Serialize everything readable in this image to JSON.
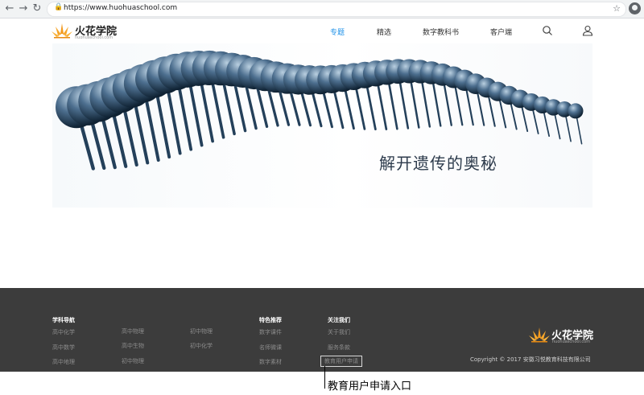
{
  "browser": {
    "url": "https://www.huohuaschool.com",
    "back_icon": "←",
    "forward_icon": "→",
    "reload_icon": "↻",
    "lock_icon": "🔒",
    "star_icon": "☆"
  },
  "header": {
    "brand_name": "火花学院",
    "brand_domain": "huohuaschool.com",
    "menu": [
      {
        "label": "专题",
        "active": true
      },
      {
        "label": "精选",
        "active": false
      },
      {
        "label": "数字教科书",
        "active": false
      },
      {
        "label": "客户端",
        "active": false
      }
    ],
    "accent_color": "#1a8fe8",
    "logo_color": "#f39a1e"
  },
  "banner": {
    "title": "解开遗传的奥秘"
  },
  "footer": {
    "columns": [
      {
        "heading": "学科导航",
        "links": [
          "高中化学",
          "高中数学",
          "高中地理"
        ]
      },
      {
        "heading": "",
        "links": [
          "高中物理",
          "高中生物",
          "初中物理"
        ]
      },
      {
        "heading": "",
        "links": [
          "初中物理",
          "初中化学"
        ]
      },
      {
        "heading": "特色推荐",
        "links": [
          "数字课件",
          "名师微课",
          "数字素材"
        ]
      },
      {
        "heading": "关注我们",
        "links": [
          "关于我们",
          "服务条款",
          "教育用户申请"
        ]
      }
    ],
    "brand_name": "火花学院",
    "brand_domain": "huohuaschool.com",
    "copyright": "Copyright © 2017 安徽习悦教育科技有限公司"
  },
  "annotation": {
    "label": "教育用户申请入口"
  }
}
